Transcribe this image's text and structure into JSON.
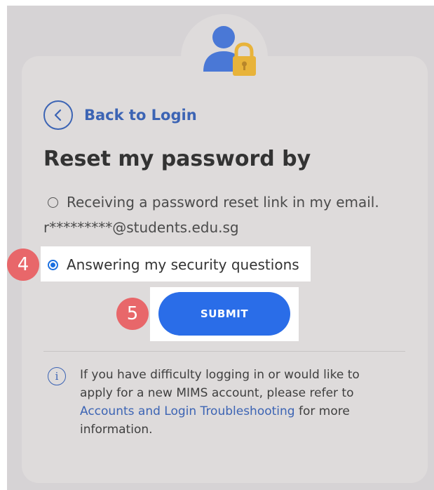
{
  "nav": {
    "back_label": "Back to Login"
  },
  "form": {
    "heading": "Reset my password by",
    "options": [
      {
        "label": "Receiving a password reset link in my email.",
        "selected": false
      },
      {
        "label": "Answering my security questions",
        "selected": true
      }
    ],
    "masked_email": "r*********@students.edu.sg",
    "submit_label": "SUBMIT"
  },
  "annotations": {
    "step_4": "4",
    "step_5": "5"
  },
  "info": {
    "text_before": "If you have difficulty logging in or would like to apply for a new MIMS account, please refer to ",
    "link_text": "Accounts and Login Troubleshooting",
    "text_after": " for more information."
  },
  "colors": {
    "accent_blue": "#2a6de8",
    "link_blue": "#3c64b4",
    "badge_red": "#e8676a",
    "lock_gold": "#e8b33a",
    "background_grey": "#d6d3d5",
    "card_grey": "#dedbdb"
  },
  "icons": {
    "header": "user-lock-icon",
    "back": "chevron-left-icon",
    "info": "info-icon"
  }
}
